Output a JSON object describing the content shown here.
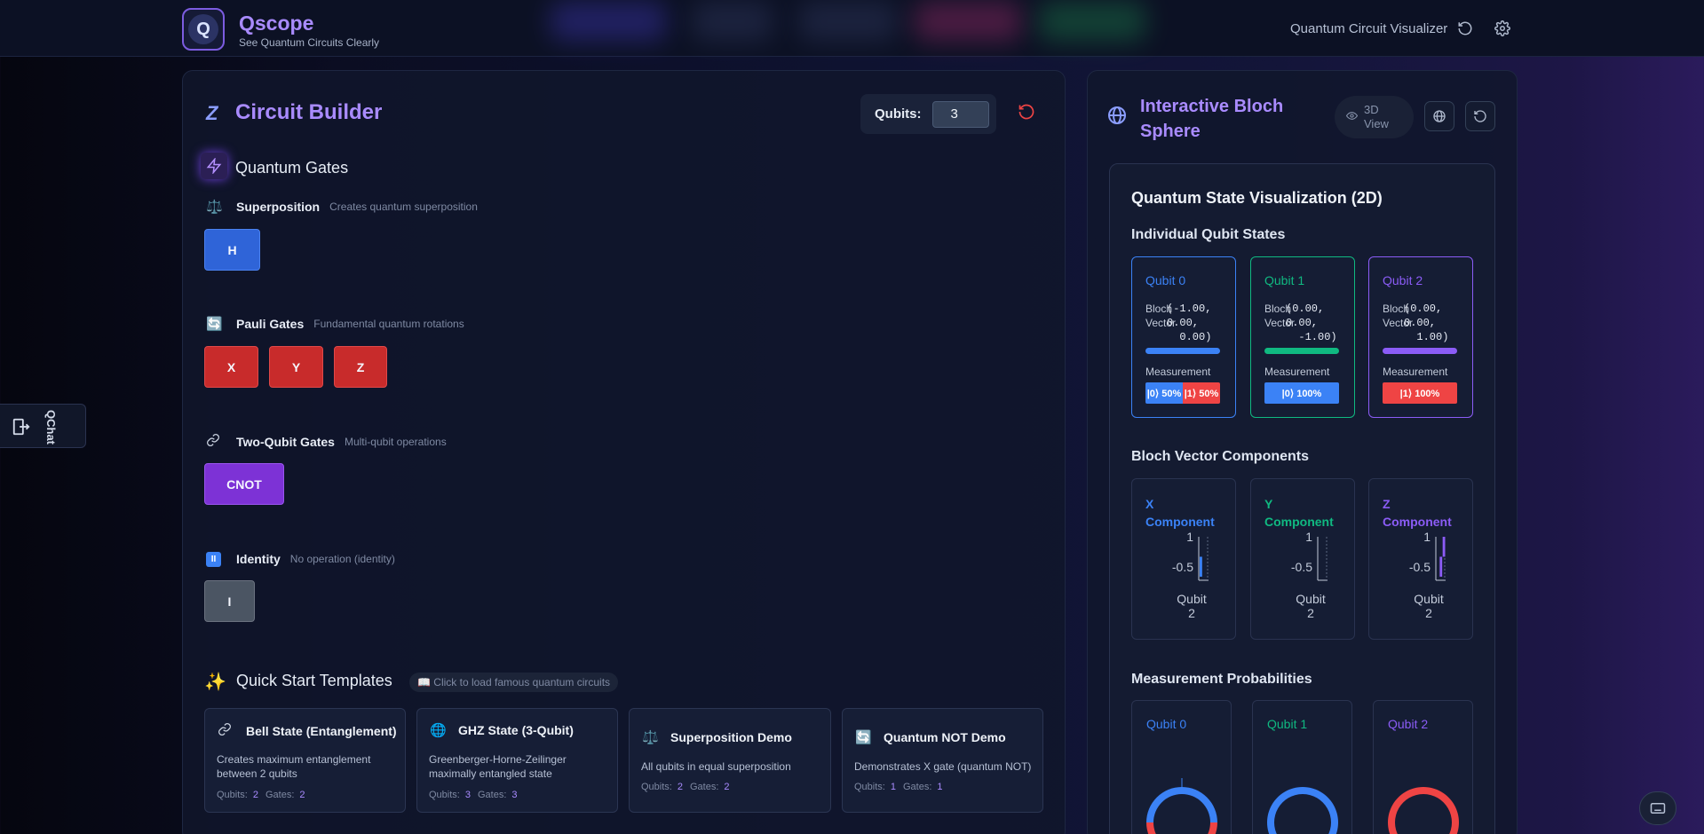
{
  "header": {
    "app_name": "Qscope",
    "logo_letter": "Q",
    "tagline": "See Quantum Circuits Clearly",
    "nav_label": "Quantum Circuit Visualizer",
    "icons": [
      "reset-icon",
      "gear-icon"
    ]
  },
  "circuit_builder": {
    "title": "Circuit Builder",
    "qubits_label": "Qubits:",
    "qubits_value": "3",
    "gates_title": "Quantum Gates",
    "sections": [
      {
        "name": "Superposition",
        "desc": "Creates quantum superposition",
        "icon": "scale-icon",
        "gates": [
          "H"
        ]
      },
      {
        "name": "Pauli Gates",
        "desc": "Fundamental quantum rotations",
        "icon": "cycle-icon",
        "gates": [
          "X",
          "Y",
          "Z"
        ]
      },
      {
        "name": "Two-Qubit Gates",
        "desc": "Multi-qubit operations",
        "icon": "link-icon",
        "gates": [
          "CNOT"
        ]
      },
      {
        "name": "Identity",
        "desc": "No operation (identity)",
        "icon": "pause-icon",
        "gates": [
          "I"
        ]
      }
    ],
    "templates_title": "Quick Start Templates",
    "templates_hint": "Click to load famous quantum circuits",
    "templates": [
      {
        "name": "Bell State (Entanglement)",
        "desc": [
          "Creates maximum entanglement",
          "between 2 qubits"
        ],
        "qubits": "2",
        "gates": "2",
        "icon": "link-icon"
      },
      {
        "name": "GHZ State (3-Qubit)",
        "desc": [
          "Greenberger-Horne-Zeilinger",
          "maximally entangled state"
        ],
        "qubits": "3",
        "gates": "3",
        "icon": "globe-icon"
      },
      {
        "name": "Superposition Demo",
        "desc": [
          "All qubits in equal superposition"
        ],
        "qubits": "2",
        "gates": "2",
        "icon": "scale-icon"
      },
      {
        "name": "Quantum NOT Demo",
        "desc": [
          "Demonstrates X gate (quantum NOT)"
        ],
        "qubits": "1",
        "gates": "1",
        "icon": "cycle-icon"
      }
    ],
    "qubits_meta_label": "Qubits:",
    "gates_meta_label": "Gates:"
  },
  "qchat": {
    "label": "QChat"
  },
  "bloch": {
    "title_line1": "Interactive Bloch",
    "title_line2": "Sphere",
    "view_label_1": "3D",
    "view_label_2": "View",
    "viz_title": "Quantum State Visualization (2D)",
    "individual_title": "Individual Qubit States",
    "bloch_vector_label_1": "Bloch",
    "bloch_vector_label_2": "Vector",
    "measurement_label": "Measurement",
    "qubits": [
      {
        "name": "Qubit 0",
        "vector": "(-1.00,\n0.00,\n  0.00)",
        "color": "#3b82f6",
        "measurement": [
          {
            "label": "|0⟩ 50%",
            "fraction": 0.5,
            "color": "#3b82f6"
          },
          {
            "label": "|1⟩ 50%",
            "fraction": 0.5,
            "color": "#ef4444"
          }
        ]
      },
      {
        "name": "Qubit 1",
        "vector": "(0.00,\n0.00,\n  -1.00)",
        "color": "#10b981",
        "measurement": [
          {
            "label": "|0⟩ 100%",
            "fraction": 1.0,
            "color": "#3b82f6"
          }
        ]
      },
      {
        "name": "Qubit 2",
        "vector": "(0.00,\n0.00,\n  1.00)",
        "color": "#8b5cf6",
        "measurement": [
          {
            "label": "|1⟩ 100%",
            "fraction": 1.0,
            "color": "#ef4444"
          }
        ]
      }
    ],
    "components_title": "Bloch Vector Components",
    "components": [
      {
        "name_1": "X",
        "name_2": "Component",
        "color": "#3b82f6",
        "values": [
          -1.0,
          0.0,
          0.0
        ]
      },
      {
        "name_1": "Y",
        "name_2": "Component",
        "color": "#10b981",
        "values": [
          0.0,
          0.0,
          0.0
        ]
      },
      {
        "name_1": "Z",
        "name_2": "Component",
        "color": "#8b5cf6",
        "values": [
          0.0,
          -1.0,
          1.0
        ]
      }
    ],
    "component_ticks": [
      "1",
      "-0.5"
    ],
    "component_xlabel_1": "Qubit",
    "component_xlabel_2": "2",
    "probabilities_title": "Measurement Probabilities",
    "prob_cards": [
      {
        "name": "Qubit 0",
        "color": "#3b82f6",
        "p0": 0.5,
        "p1": 0.5
      },
      {
        "name": "Qubit 1",
        "color": "#10b981",
        "p0": 1.0,
        "p1": 0.0
      },
      {
        "name": "Qubit 2",
        "color": "#8b5cf6",
        "p0": 0.0,
        "p1": 1.0
      }
    ]
  },
  "colors": {
    "accent": "#a98bff",
    "blue": "#3b82f6",
    "red": "#ef4444",
    "green": "#10b981",
    "purple": "#8b5cf6"
  }
}
